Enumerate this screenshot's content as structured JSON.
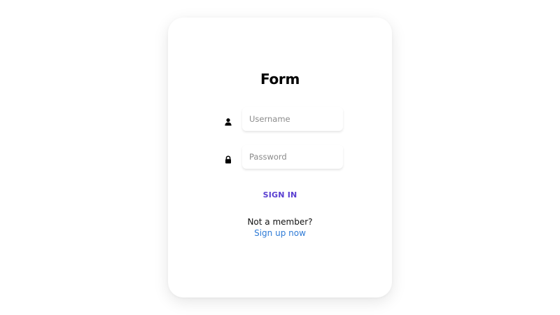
{
  "form": {
    "title": "Form",
    "username": {
      "placeholder": "Username",
      "value": "",
      "icon": "user-icon"
    },
    "password": {
      "placeholder": "Password",
      "value": "",
      "icon": "lock-icon"
    },
    "signin_label": "SIGN IN",
    "member_prompt": "Not a member?",
    "signup_link": "Sign up now"
  },
  "colors": {
    "signin": "#5a3fd1",
    "link": "#2f7bd6",
    "card": "#ffffff",
    "text": "#000000"
  }
}
